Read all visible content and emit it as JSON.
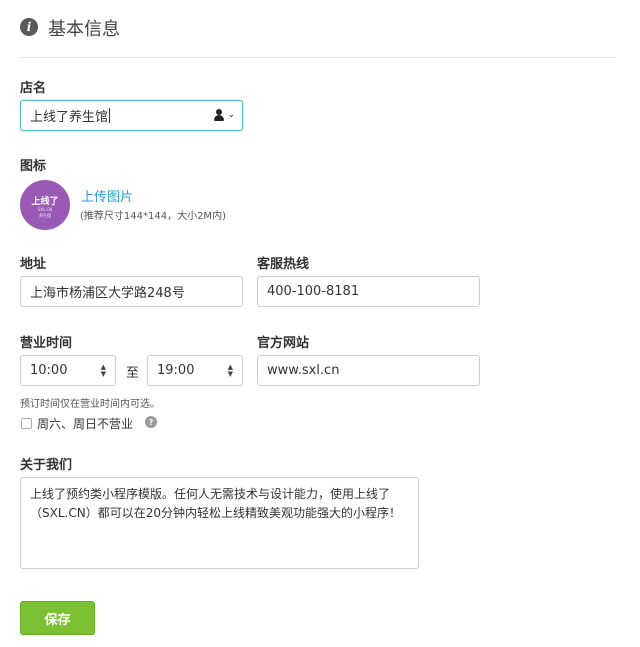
{
  "header": {
    "title": "基本信息",
    "info_icon": "info-circle-icon"
  },
  "shop_name": {
    "label": "店名",
    "value": "上线了养生馆",
    "menu_icon": "user-dropdown-icon"
  },
  "logo": {
    "label": "图标",
    "avatar_text": "上线了",
    "avatar_sub1": "SXL.CN",
    "avatar_sub2": "养生馆",
    "upload_label": "上传图片",
    "upload_hint": "(推荐尺寸144*144，大小2M内)"
  },
  "address": {
    "label": "地址",
    "value": "上海市杨浦区大学路248号"
  },
  "hotline": {
    "label": "客服热线",
    "value": "400-100-8181"
  },
  "hours": {
    "label": "营业时间",
    "start": "10:00",
    "to": "至",
    "end": "19:00",
    "hint": "预订时间仅在营业时间内可选。",
    "weekend_closed_label": "周六、周日不营业",
    "weekend_closed_checked": false,
    "help_icon_text": "?"
  },
  "website": {
    "label": "官方网站",
    "value": "www.sxl.cn"
  },
  "about": {
    "label": "关于我们",
    "value": "上线了预约类小程序模版。任何人无需技术与设计能力，使用上线了（SXL.CN）都可以在20分钟内轻松上线精致美观功能强大的小程序！"
  },
  "actions": {
    "save_label": "保存"
  },
  "colors": {
    "primary_button": "#7cc034",
    "link": "#2a9fd6",
    "focus_border": "#58b7c4",
    "avatar_bg": "#9b59b6"
  }
}
